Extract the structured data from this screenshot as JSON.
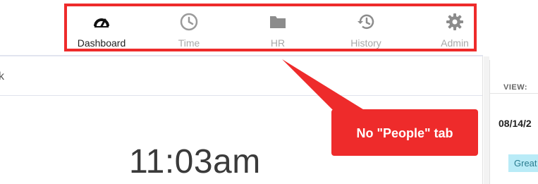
{
  "nav": {
    "items": [
      {
        "label": "Dashboard",
        "icon": "dashboard-gauge-icon",
        "active": true
      },
      {
        "label": "Time",
        "icon": "clock-icon",
        "active": false
      },
      {
        "label": "HR",
        "icon": "folder-icon",
        "active": false
      },
      {
        "label": "History",
        "icon": "history-icon",
        "active": false
      },
      {
        "label": "Admin",
        "icon": "gear-icon",
        "active": false
      }
    ]
  },
  "panel": {
    "header_fragment": "k",
    "clock": "11:03am"
  },
  "right_panel": {
    "view_label": "VIEW:",
    "date": "08/14/2",
    "badge": "Great"
  },
  "annotation": {
    "text": "No \"People\" tab"
  },
  "colors": {
    "highlight": "#ee2b2b",
    "active_text": "#222222",
    "inactive": "#a8a8a8",
    "badge_bg": "#b9ebf7"
  }
}
